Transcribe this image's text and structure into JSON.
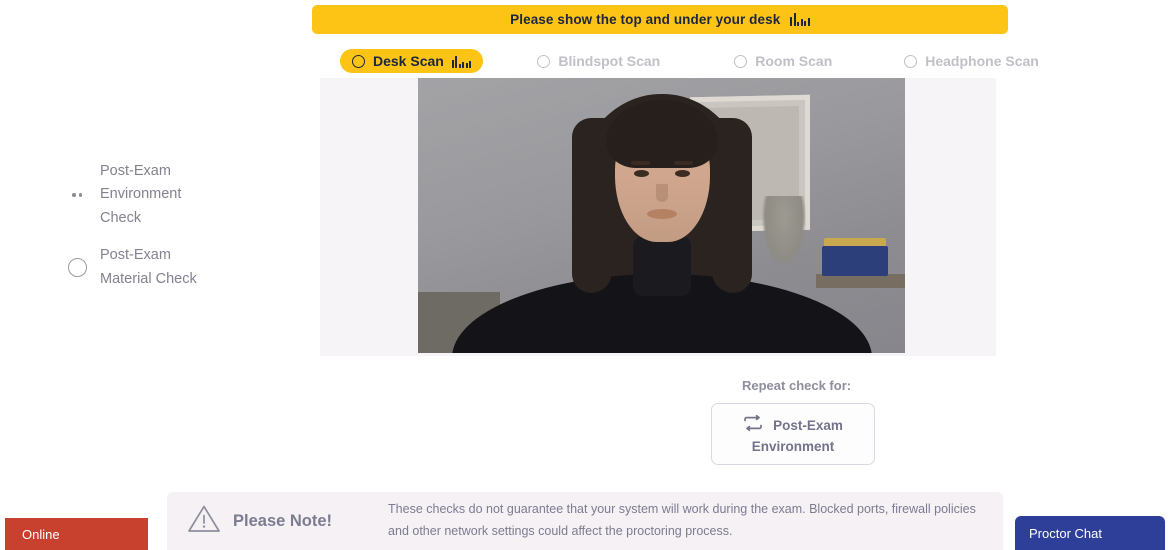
{
  "banner": {
    "text": "Please show the top and under your desk",
    "icon": "audio-waveform-icon",
    "bg_color": "#fdc416"
  },
  "tabs": [
    {
      "label": "Desk Scan",
      "active": true,
      "icon": "audio-waveform-icon"
    },
    {
      "label": "Blindspot Scan",
      "active": false
    },
    {
      "label": "Room Scan",
      "active": false
    },
    {
      "label": "Headphone Scan",
      "active": false
    }
  ],
  "video": {
    "name": "webcam-proctoring-feed",
    "state": "live"
  },
  "repeat": {
    "label": "Repeat check for:",
    "button_line1": "Post-Exam",
    "button_line2": "Environment",
    "icon": "repeat-icon"
  },
  "steps": [
    {
      "marker": "in-progress-dots",
      "line1": "Post-Exam",
      "line2": "Environment",
      "line3": "Check"
    },
    {
      "marker": "pending-ring",
      "line1": "Post-Exam",
      "line2": "Material Check",
      "line3": ""
    }
  ],
  "note": {
    "icon": "warning-triangle-icon",
    "title": "Please Note!",
    "line1": "These checks do not guarantee that your system will work during the exam. Blocked ports, firewall policies",
    "line2": "and other network settings could affect the proctoring process."
  },
  "status": {
    "online_label": "Online",
    "online_color": "#c8412f"
  },
  "chat": {
    "label": "Proctor Chat",
    "color": "#2e3f99"
  }
}
